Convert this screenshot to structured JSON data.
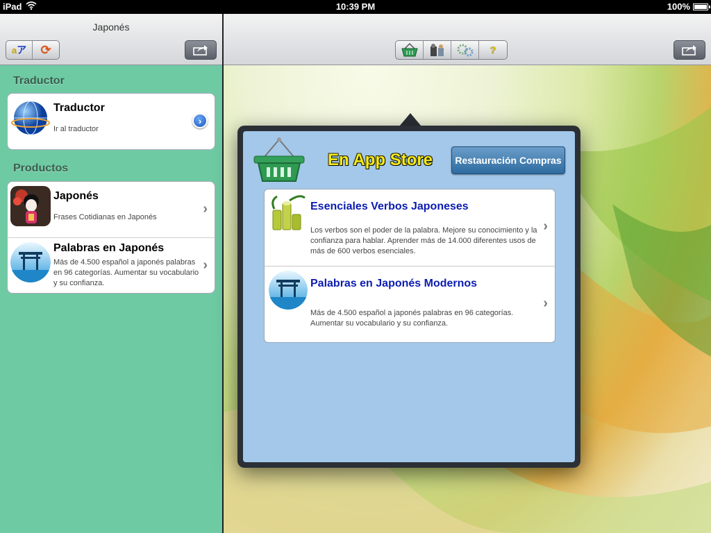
{
  "status_bar": {
    "device": "iPad",
    "time": "10:39 PM",
    "battery": "100%",
    "battery_level": 1.0
  },
  "left_pane": {
    "title": "Japonés",
    "left_segments": [
      {
        "icon": "translate-icon",
        "label": "aア"
      },
      {
        "icon": "refresh-icon",
        "label": "⟳"
      }
    ],
    "share_icon": "share-icon",
    "sections": [
      {
        "header": "Traductor",
        "items": [
          {
            "title": "Traductor",
            "subtitle": "Ir al traductor",
            "icon": "globe-icon",
            "accessory": "disclosure-button"
          }
        ]
      },
      {
        "header": "Productos",
        "items": [
          {
            "title": "Japonés",
            "subtitle": "Frases Cotidianas en Japonés",
            "icon": "geisha-icon",
            "accessory": "chevron"
          },
          {
            "title": "Palabras en Japonés",
            "subtitle": "Más de 4.500 español a japonés palabras en 96 categorías. Aumentar su vocabulario y su confianza.",
            "icon": "torii-icon",
            "accessory": "chevron"
          }
        ]
      }
    ]
  },
  "right_pane": {
    "toolbar": [
      {
        "icon": "basket-icon",
        "label": ""
      },
      {
        "icon": "people-icon",
        "label": ""
      },
      {
        "icon": "settings-icon",
        "label": ""
      },
      {
        "icon": "help-icon",
        "label": "?"
      }
    ],
    "share_icon": "share-icon"
  },
  "popover": {
    "title": "En App Store",
    "restore_button": "Restauración Compras",
    "products": [
      {
        "title": "Esenciales Verbos Japoneses",
        "description": "Los verbos son el poder de la palabra. Mejore su conocimiento y la confianza para hablar. Aprender más de 14.000 diferentes usos de más de 600 verbos esenciales.",
        "icon": "bamboo-icon"
      },
      {
        "title": "Palabras en Japonés Modernos",
        "description": "Más de 4.500 español a japonés palabras en 96 categorías. Aumentar su vocabulario y su confianza.",
        "icon": "torii-icon"
      }
    ]
  },
  "colors": {
    "sidebar_bg": "#6ecaa3",
    "popover_bg": "#a3c8e9",
    "popover_title": "#f5e91d",
    "product_title": "#0b1cb0",
    "restore_button": "#3f7fb5"
  }
}
